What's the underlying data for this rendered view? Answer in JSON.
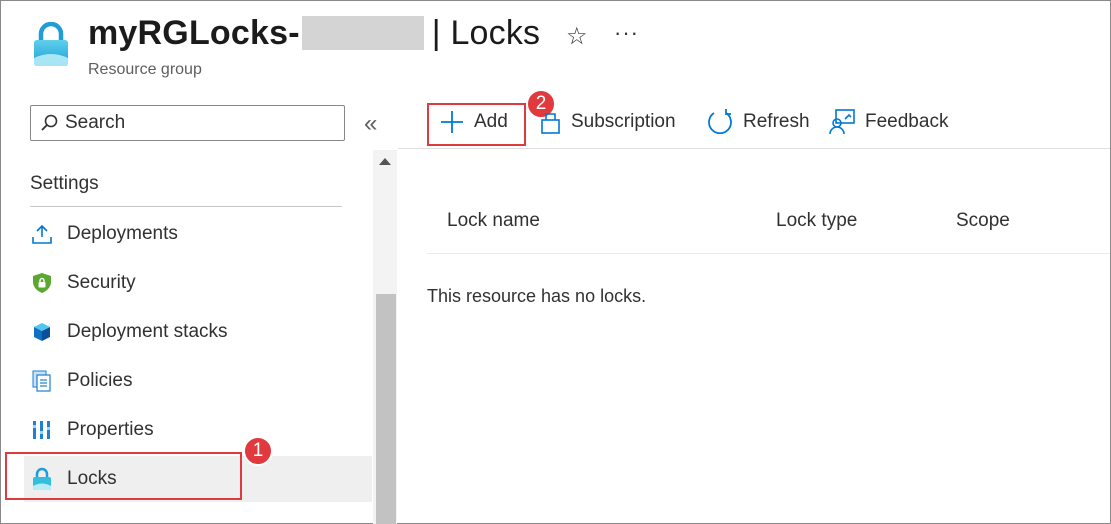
{
  "header": {
    "title_prefix": "myRGLocks-",
    "title_separator": "|",
    "title_page": "Locks",
    "subtitle": "Resource group",
    "favorite_glyph": "☆",
    "more_glyph": "···"
  },
  "sidebar": {
    "search_placeholder": "Search",
    "collapse_glyph": "«",
    "section": "Settings",
    "items": [
      {
        "label": "Deployments",
        "icon": "upload-icon"
      },
      {
        "label": "Security",
        "icon": "shield-icon"
      },
      {
        "label": "Deployment stacks",
        "icon": "cube-stack-icon"
      },
      {
        "label": "Policies",
        "icon": "policy-document-icon"
      },
      {
        "label": "Properties",
        "icon": "properties-bars-icon"
      },
      {
        "label": "Locks",
        "icon": "lock-icon",
        "selected": true
      }
    ]
  },
  "toolbar": {
    "add": "Add",
    "subscription": "Subscription",
    "refresh": "Refresh",
    "feedback": "Feedback"
  },
  "table": {
    "columns": [
      "Lock name",
      "Lock type",
      "Scope"
    ],
    "empty_message": "This resource has no locks."
  },
  "callouts": [
    "1",
    "2"
  ],
  "colors": {
    "callout_red": "#e0393e",
    "azure_blue": "#0078d4",
    "lock_cyan": "#32bedd"
  }
}
